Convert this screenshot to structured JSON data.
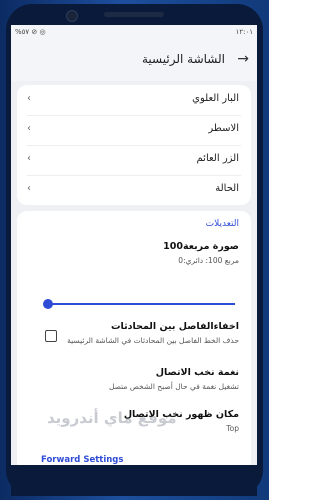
{
  "status_bar": {
    "left": "%٥٧ ⊘ ◎",
    "right": "١٢:٠١"
  },
  "app_bar": {
    "title": "الشاشة الرئيسية",
    "back_glyph": "→"
  },
  "main_items": [
    {
      "label": "البار العلوي"
    },
    {
      "label": "الاسطر"
    },
    {
      "label": "الزر العائم"
    },
    {
      "label": "الحالة"
    }
  ],
  "settings": {
    "section_title": "التعديلات",
    "radius": {
      "title": "100صورة مربعة",
      "subtitle": "0:مربع 100: دائري",
      "value": 0,
      "min": 0,
      "max": 100
    },
    "hide_divider": {
      "title": "اخفاءالفاصل بين المحادثات",
      "subtitle": "حذف الخط الفاصل بين المحادثات في الشاشة الرئيسية",
      "checked": false
    },
    "contact_tone": {
      "title": "نغمة نخب الاتصال",
      "subtitle": "تشغيل نغمة في حال أصبح الشخص متصل"
    },
    "contact_position": {
      "title": "مكان ظهور نخب الاتصال",
      "value": "Top"
    },
    "forward_settings": {
      "label": "Forward Settings"
    }
  },
  "watermark": "موقع ماي أندرويد",
  "chevron": "‹"
}
